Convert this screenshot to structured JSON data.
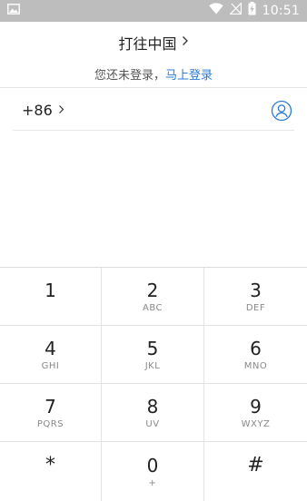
{
  "status_bar": {
    "time": "10:51",
    "icons": [
      "image-notification-icon",
      "wifi-icon",
      "no-signal-icon",
      "battery-charging-icon"
    ]
  },
  "header": {
    "title": "打往中国",
    "chevron_icon": "chevron-right-icon"
  },
  "login": {
    "prefix": "您还未登录，",
    "link": "马上登录"
  },
  "phone": {
    "country_code": "+86",
    "contact_icon": "contact-person-icon"
  },
  "keypad": {
    "keys": [
      {
        "digit": "1",
        "letters": ""
      },
      {
        "digit": "2",
        "letters": "ABC"
      },
      {
        "digit": "3",
        "letters": "DEF"
      },
      {
        "digit": "4",
        "letters": "GHI"
      },
      {
        "digit": "5",
        "letters": "JKL"
      },
      {
        "digit": "6",
        "letters": "MNO"
      },
      {
        "digit": "7",
        "letters": "PQRS"
      },
      {
        "digit": "8",
        "letters": "UV"
      },
      {
        "digit": "9",
        "letters": "WXYZ"
      },
      {
        "digit": "*",
        "letters": ""
      },
      {
        "digit": "0",
        "letters": "+"
      },
      {
        "digit": "#",
        "letters": ""
      }
    ]
  },
  "colors": {
    "status_bar_bg": "#bdbdbd",
    "link": "#2b7bd3",
    "contact_icon": "#2b7bd3",
    "divider": "#e3e3e3"
  }
}
